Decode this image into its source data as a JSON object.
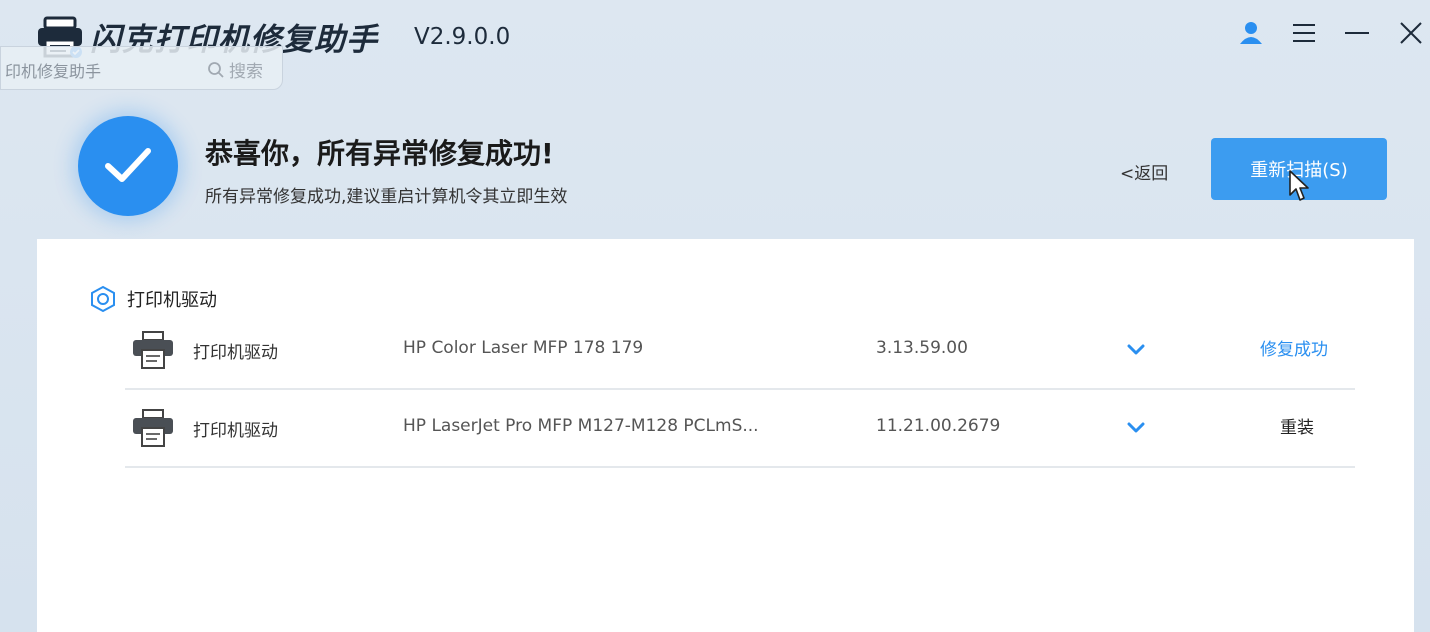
{
  "window": {
    "title": "闪克打印机修复助手",
    "version": "V2.9.0.0"
  },
  "overlay_tab": {
    "label": "印机修复助手",
    "search_label": "搜索"
  },
  "result": {
    "title": "恭喜你，所有异常修复成功!",
    "subtitle": "所有异常修复成功,建议重启计算机令其立即生效",
    "back_label": "<返回",
    "rescan_label": "重新扫描(S)"
  },
  "section": {
    "title": "打印机驱动"
  },
  "rows": [
    {
      "category": "打印机驱动",
      "model": "HP Color Laser MFP 178 179",
      "version": "3.13.59.00",
      "status": "修复成功"
    },
    {
      "category": "打印机驱动",
      "model": "HP LaserJet Pro MFP M127-M128 PCLmS...",
      "version": "11.21.00.2679",
      "status": "重装"
    }
  ],
  "colors": {
    "accent": "#2a8ff0",
    "button": "#3c9cf0",
    "success_text": "#2a8ff0"
  },
  "icons": {
    "logo": "printer-logo-icon",
    "user": "user-icon",
    "menu": "menu-icon",
    "minimize": "minimize-icon",
    "close": "close-icon",
    "check": "check-icon",
    "section": "hexagon-icon",
    "row": "printer-icon",
    "expand": "chevron-down-icon"
  }
}
